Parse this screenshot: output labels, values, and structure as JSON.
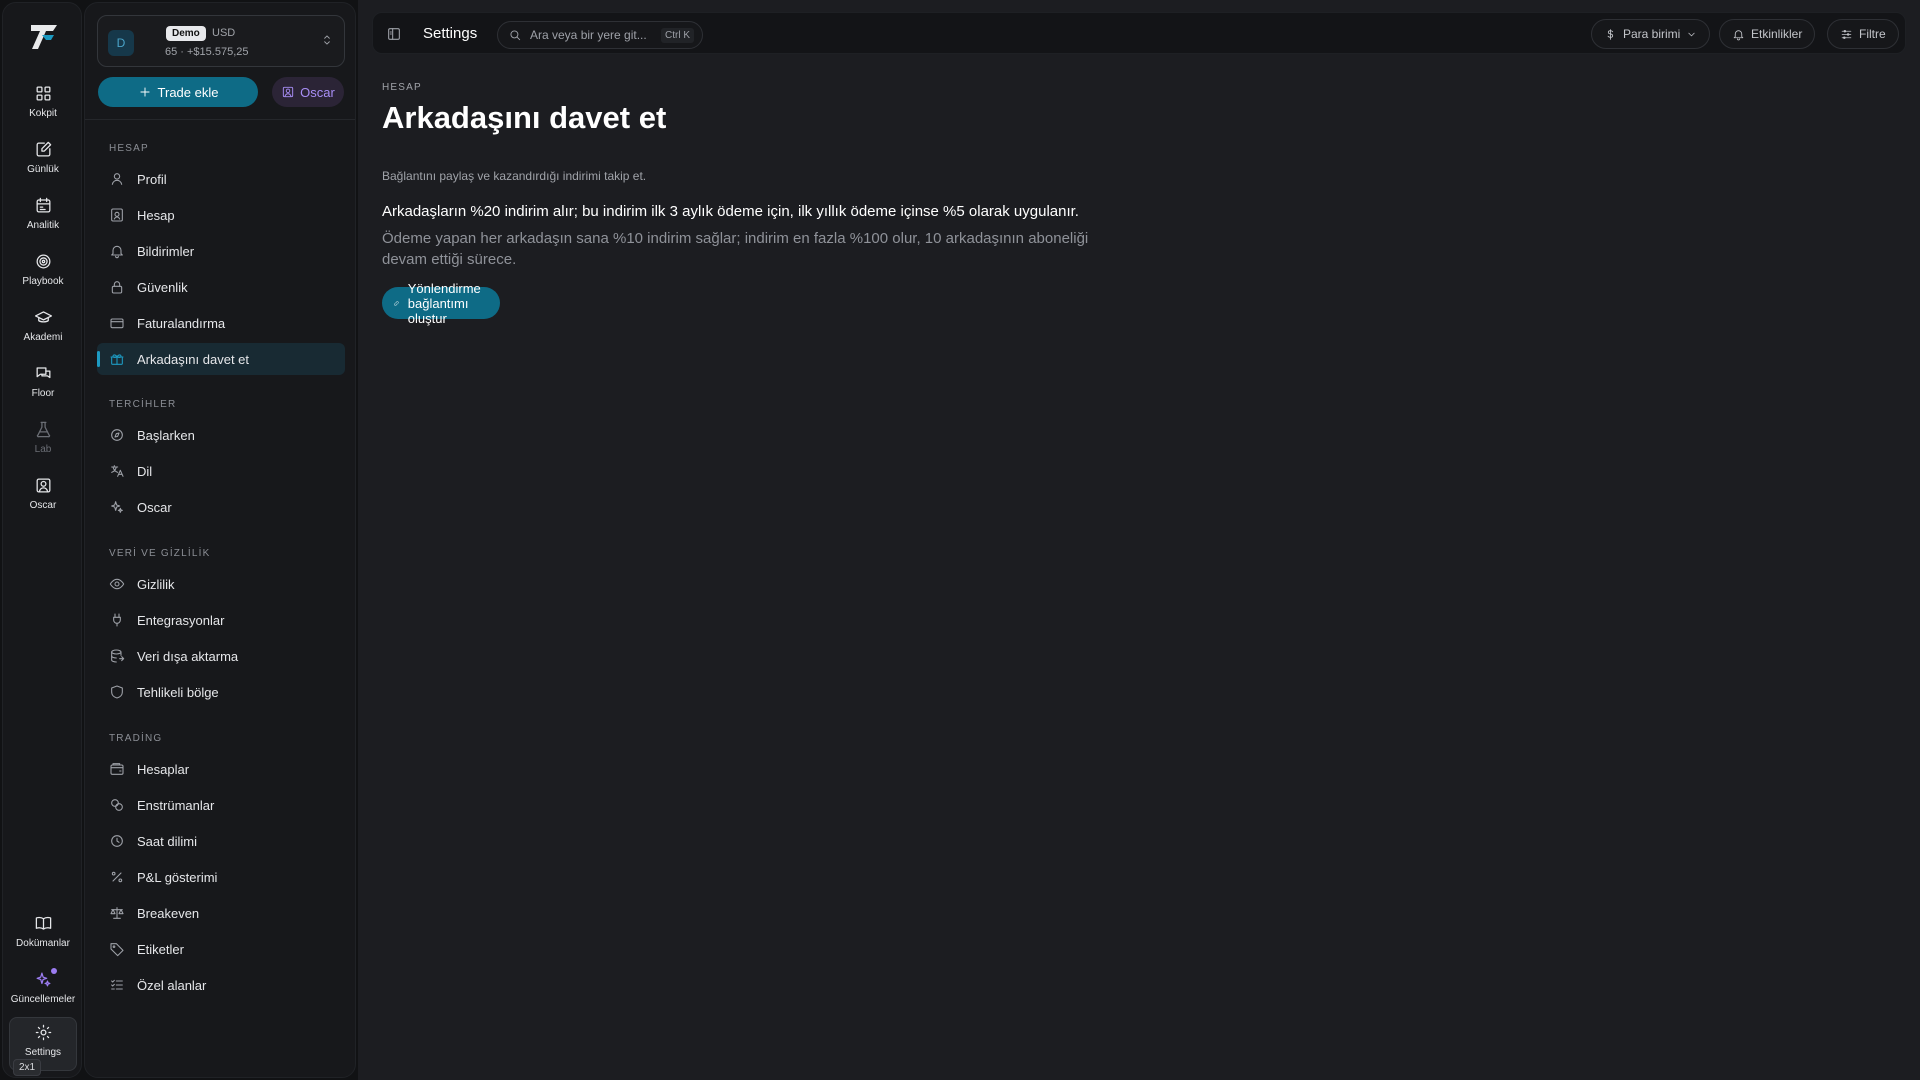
{
  "rail": {
    "items": [
      {
        "label": "Kokpit",
        "icon": "grid-icon"
      },
      {
        "label": "Günlük",
        "icon": "journal-icon"
      },
      {
        "label": "Analitik",
        "icon": "calendar-icon"
      },
      {
        "label": "Playbook",
        "icon": "target-icon"
      },
      {
        "label": "Akademi",
        "icon": "graduation-icon"
      },
      {
        "label": "Floor",
        "icon": "chat-icon"
      },
      {
        "label": "Lab",
        "icon": "flask-icon"
      },
      {
        "label": "Oscar",
        "icon": "user-square-icon"
      }
    ],
    "bottom": [
      {
        "label": "Dokümanlar",
        "icon": "book-icon"
      },
      {
        "label": "Güncellemeler",
        "icon": "sparkles-icon"
      },
      {
        "label": "Settings",
        "icon": "gear-icon"
      }
    ],
    "badge": "2x1"
  },
  "account": {
    "avatar": "D",
    "mode": "Demo",
    "currency": "USD",
    "meta": "65 · +$15.575,25"
  },
  "actions": {
    "trade": "Trade ekle",
    "oscar": "Oscar"
  },
  "sections": {
    "hesap": "HESAP",
    "tercihler": "TERCİHLER",
    "veri": "VERİ VE GİZLİLİK",
    "trading": "TRADİNG"
  },
  "nav": {
    "profil": "Profil",
    "hesap": "Hesap",
    "bildirimler": "Bildirimler",
    "guvenlik": "Güvenlik",
    "faturalandirma": "Faturalandırma",
    "davet": "Arkadaşını davet et",
    "baslarken": "Başlarken",
    "dil": "Dil",
    "oscar": "Oscar",
    "gizlilik": "Gizlilik",
    "entegrasyonlar": "Entegrasyonlar",
    "disa_aktarma": "Veri dışa aktarma",
    "tehlikeli": "Tehlikeli bölge",
    "hesaplar": "Hesaplar",
    "enstrumanlar": "Enstrümanlar",
    "saat": "Saat dilimi",
    "pnl": "P&L gösterimi",
    "breakeven": "Breakeven",
    "etiketler": "Etiketler",
    "ozel": "Özel alanlar"
  },
  "topbar": {
    "title": "Settings",
    "search_placeholder": "Ara veya bir yere git...",
    "shortcut": "Ctrl K",
    "currency": "Para birimi",
    "events": "Etkinlikler",
    "filter": "Filtre"
  },
  "page": {
    "crumb": "HESAP",
    "title": "Arkadaşını davet et",
    "subtitle": "Bağlantını paylaş ve kazandırdığı indirimi takip et.",
    "para1": "Arkadaşların %20 indirim alır; bu indirim ilk 3 aylık ödeme için, ilk yıllık ödeme içinse %5 olarak uygulanır.",
    "para2": "Ödeme yapan her arkadaşın sana %10 indirim sağlar; indirim en fazla %100 olur, 10 arkadaşının aboneliği devam ettiği sürece.",
    "cta": "Yönlendirme bağlantımı oluştur"
  },
  "colors": {
    "accent": "#0e6b86",
    "highlight": "#1d9ac2",
    "purple": "#9b7cf0"
  }
}
